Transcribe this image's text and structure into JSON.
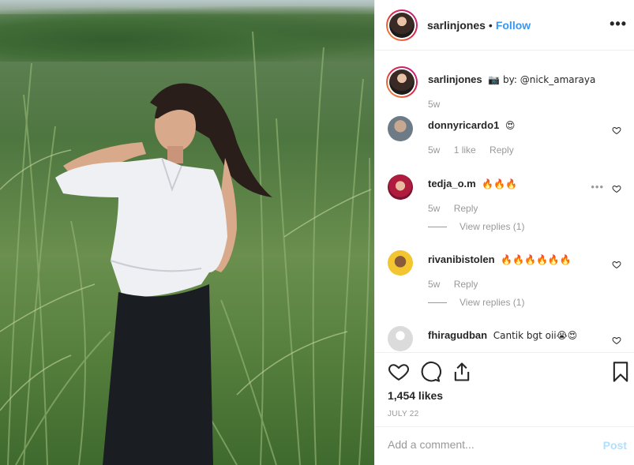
{
  "post": {
    "author": "sarlinjones",
    "dot": "•",
    "follow_label": "Follow",
    "more_label": "•••",
    "caption_user": "sarlinjones",
    "caption_text": "📷 by: @nick_amaraya",
    "caption_time": "5w"
  },
  "comments": [
    {
      "user": "donnyricardo1",
      "text": "😍",
      "time": "5w",
      "likes": "1 like",
      "reply": "Reply",
      "view_replies": ""
    },
    {
      "user": "tedja_o.m",
      "text": "🔥🔥🔥",
      "time": "5w",
      "likes": "",
      "reply": "Reply",
      "view_replies": "View replies (1)"
    },
    {
      "user": "rivanibistolen",
      "text": "🔥🔥🔥🔥🔥🔥",
      "time": "5w",
      "likes": "",
      "reply": "Reply",
      "view_replies": "View replies (1)"
    },
    {
      "user": "fhiragudban",
      "text": "Cantik bgt oii😭😍",
      "time": "",
      "likes": "",
      "reply": "",
      "view_replies": ""
    }
  ],
  "actions": {
    "likes": "1,454 likes",
    "date": "JULY 22"
  },
  "add_comment": {
    "placeholder": "Add a comment...",
    "post_label": "Post"
  },
  "colors": {
    "accent": "#3897f0",
    "post_disabled": "#b2dffc",
    "muted": "#999999"
  }
}
